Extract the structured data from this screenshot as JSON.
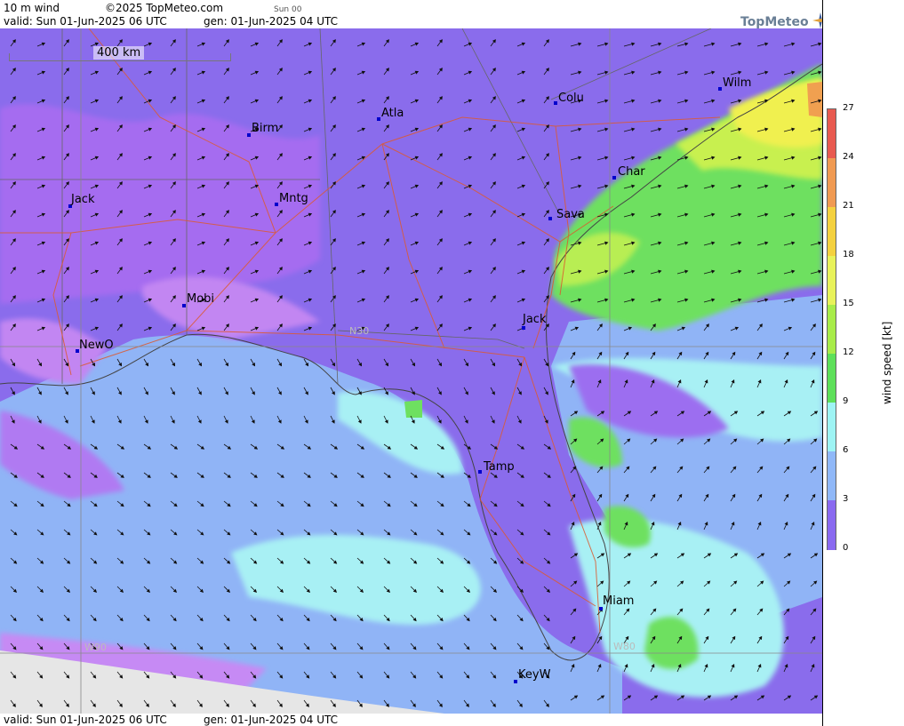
{
  "header": {
    "product": "10 m wind",
    "copyright": "©2025 TopMeteo.com",
    "run": "Sun 00",
    "valid": "valid:  Sun  01-Jun-2025  06 UTC",
    "gen": "gen: 01-Jun-2025 04 UTC"
  },
  "footer": {
    "valid": "valid:  Sun  01-Jun-2025  06 UTC",
    "gen": "gen: 01-Jun-2025 04 UTC"
  },
  "logo": {
    "text": "TopMeteo"
  },
  "scale_bar": {
    "label": "400 km"
  },
  "cities": [
    {
      "name": "Birm"
    },
    {
      "name": "Atla"
    },
    {
      "name": "Colu"
    },
    {
      "name": "Wilm"
    },
    {
      "name": "Jack"
    },
    {
      "name": "Mntg"
    },
    {
      "name": "Char"
    },
    {
      "name": "Sava"
    },
    {
      "name": "Mobi"
    },
    {
      "name": "Jack"
    },
    {
      "name": "NewO"
    },
    {
      "name": "Tamp"
    },
    {
      "name": "Miam"
    },
    {
      "name": "KeyW"
    }
  ],
  "coords": {
    "lat": "N30",
    "lon1": "W90",
    "lon2": "W80"
  },
  "colorbar": {
    "title": "wind speed [kt]",
    "ticks": [
      "27",
      "24",
      "21",
      "18",
      "15",
      "12",
      "9",
      "6",
      "3",
      "0"
    ],
    "colors": [
      "#e85a50",
      "#f09a52",
      "#f4d13f",
      "#e8f25a",
      "#a8ec4a",
      "#5ee05a",
      "#9ef4f4",
      "#90b8f8",
      "#8a6af0",
      "#c88af4"
    ]
  }
}
